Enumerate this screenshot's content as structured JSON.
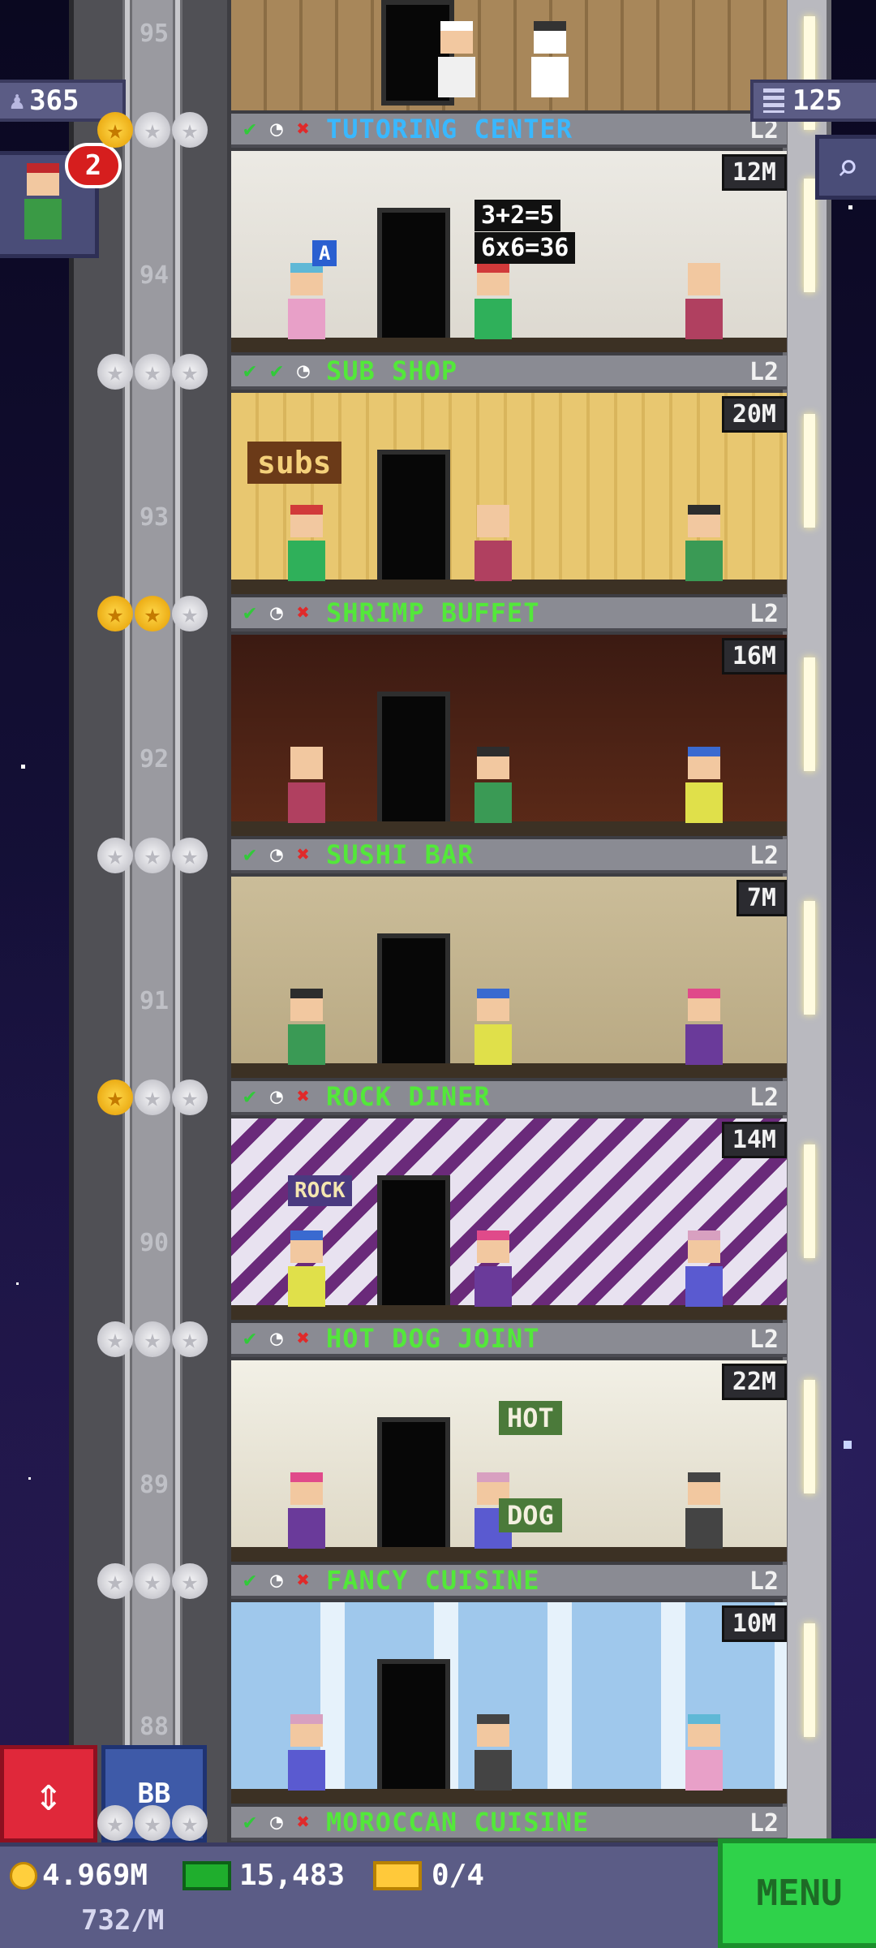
{
  "hud": {
    "population": "365",
    "floors": "125",
    "visitor_badge": "2",
    "elevator_label": "⇕",
    "bb_label": "BB",
    "menu_label": "MENU"
  },
  "wallet": {
    "coins": "4.969M",
    "rate": "732/M",
    "bux": "15,483",
    "tickets": "0/4"
  },
  "shaft_numbers": [
    "95",
    "94",
    "93",
    "92",
    "91",
    "90",
    "89",
    "88"
  ],
  "floors": [
    {
      "name": "TUTORING CENTER",
      "level": "L2",
      "price": "12M",
      "name_color": "#39b8ff",
      "status": [
        "ok",
        "clk",
        "no"
      ],
      "stars": [
        1,
        0,
        0
      ]
    },
    {
      "name": "SUB SHOP",
      "level": "L2",
      "price": "20M",
      "name_color": "#53e83a",
      "status": [
        "ok",
        "ok",
        "clk"
      ],
      "stars": [
        0,
        0,
        0
      ]
    },
    {
      "name": "SHRIMP BUFFET",
      "level": "L2",
      "price": "16M",
      "name_color": "#53e83a",
      "status": [
        "ok",
        "clk",
        "no"
      ],
      "stars": [
        1,
        1,
        0
      ]
    },
    {
      "name": "SUSHI BAR",
      "level": "L2",
      "price": "7M",
      "name_color": "#53e83a",
      "status": [
        "ok",
        "clk",
        "no"
      ],
      "stars": [
        0,
        0,
        0
      ]
    },
    {
      "name": "ROCK DINER",
      "level": "L2",
      "price": "14M",
      "name_color": "#53e83a",
      "status": [
        "ok",
        "clk",
        "no"
      ],
      "stars": [
        1,
        0,
        0
      ]
    },
    {
      "name": "HOT DOG JOINT",
      "level": "L2",
      "price": "22M",
      "name_color": "#53e83a",
      "status": [
        "ok",
        "clk",
        "no"
      ],
      "stars": [
        0,
        0,
        0
      ]
    },
    {
      "name": "FANCY CUISINE",
      "level": "L2",
      "price": "10M",
      "name_color": "#53e83a",
      "status": [
        "ok",
        "clk",
        "no"
      ],
      "stars": [
        0,
        0,
        0
      ]
    },
    {
      "name": "MOROCCAN CUISINE",
      "level": "L2",
      "price": "",
      "name_color": "#53e83a",
      "status": [
        "ok",
        "clk",
        "no"
      ],
      "stars": [
        0,
        0,
        0
      ]
    }
  ],
  "room_text": {
    "tutoring_board_line1": "3+2=5",
    "tutoring_board_line2": "6x6=36",
    "tutoring_poster": "A",
    "sub_sign": "subs",
    "diner_sign": "ROCK",
    "hotdog_sign_top": "HOT",
    "hotdog_sign_bottom": "DOG"
  },
  "icons": {
    "population": "person-icon",
    "floors": "building-icon",
    "search": "magnifier-icon",
    "coin": "coin-icon",
    "bux": "bux-icon",
    "ticket": "ticket-icon",
    "status_ok": "check-icon",
    "status_clock": "clock-icon",
    "status_no": "x-icon"
  }
}
